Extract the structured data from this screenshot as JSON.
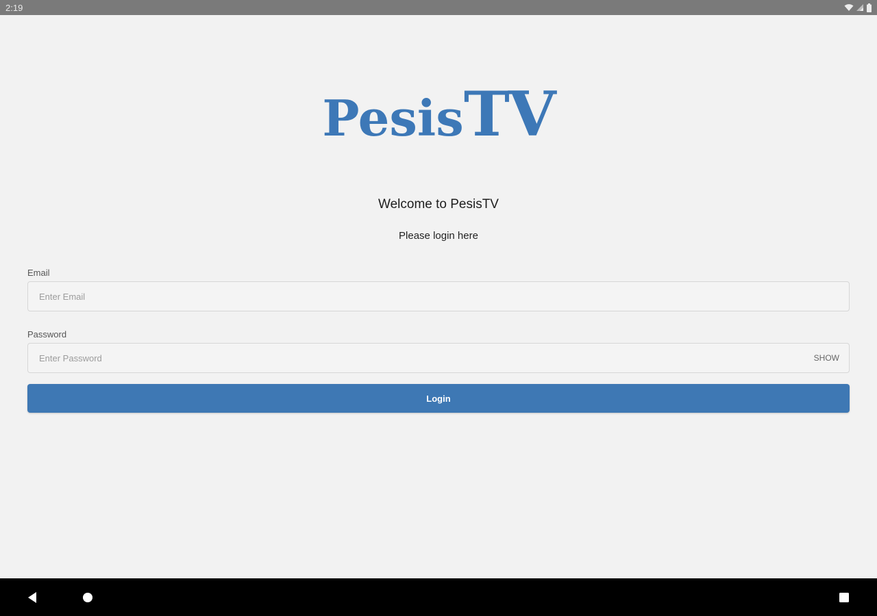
{
  "status_bar": {
    "time": "2:19",
    "icons": [
      "wifi-icon",
      "signal-icon",
      "battery-icon"
    ]
  },
  "logo": {
    "part_a": "Pesis",
    "part_b": "TV",
    "color": "#3d78b7"
  },
  "welcome": {
    "title": "Welcome to PesisTV",
    "subtitle": "Please login here"
  },
  "form": {
    "email_label": "Email",
    "email_placeholder": "Enter Email",
    "email_value": "",
    "password_label": "Password",
    "password_placeholder": "Enter Password",
    "password_value": "",
    "show_label": "SHOW",
    "login_label": "Login",
    "accent_color": "#3e78b4"
  },
  "nav_bar": {
    "icons": [
      "back-icon",
      "home-icon",
      "recents-icon"
    ]
  }
}
